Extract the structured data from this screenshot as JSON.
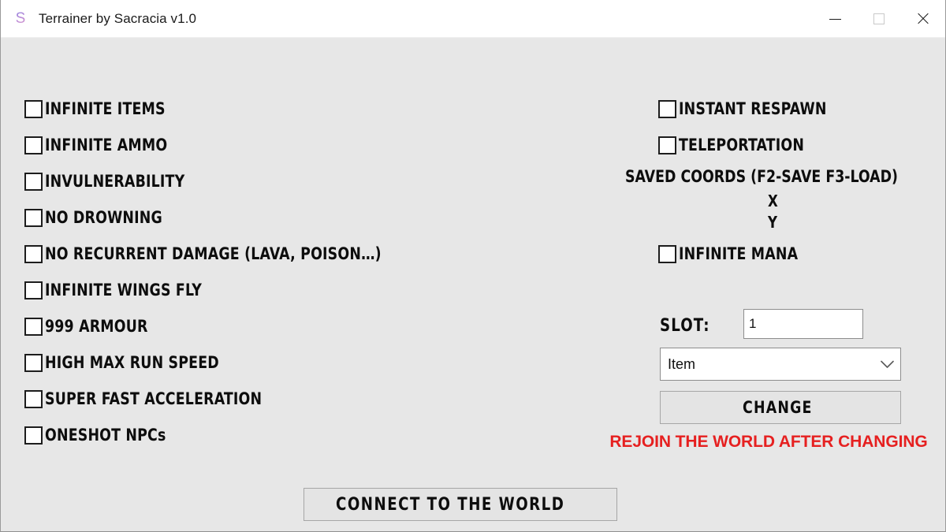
{
  "window": {
    "title": "Terrainer by Sacracia v1.0",
    "icon": "S",
    "controls": {
      "minimize": "minimize-icon",
      "maximize": "maximize-icon",
      "close": "close-icon"
    }
  },
  "left_column": {
    "checkboxes": [
      {
        "id": "infinite-items",
        "label": "INFINITE ITEMS",
        "checked": false
      },
      {
        "id": "infinite-ammo",
        "label": "INFINITE AMMO",
        "checked": false
      },
      {
        "id": "invulnerability",
        "label": "INVULNERABILITY",
        "checked": false
      },
      {
        "id": "no-drowning",
        "label": "NO DROWNING",
        "checked": false
      },
      {
        "id": "no-recurrent-damage",
        "label": "NO RECURRENT DAMAGE (LAVA, POISON…)",
        "checked": false
      },
      {
        "id": "infinite-wings-fly",
        "label": "INFINITE WINGS FLY",
        "checked": false
      },
      {
        "id": "999-armour",
        "label": "999 ARMOUR",
        "checked": false
      },
      {
        "id": "high-max-run-speed",
        "label": "HIGH MAX RUN SPEED",
        "checked": false
      },
      {
        "id": "super-fast-accel",
        "label": "SUPER FAST ACCELERATION",
        "checked": false
      },
      {
        "id": "oneshot-npcs",
        "label": "ONESHOT NPCs",
        "checked": false
      }
    ]
  },
  "right_column": {
    "checkboxes": [
      {
        "id": "instant-respawn",
        "label": "INSTANT RESPAWN",
        "checked": false
      },
      {
        "id": "teleportation",
        "label": "TELEPORTATION",
        "checked": false
      },
      {
        "id": "infinite-mana",
        "label": "INFINITE MANA",
        "checked": false
      }
    ],
    "saved_coords": {
      "title": "SAVED COORDS (F2-SAVE F3-LOAD)",
      "x_label": "X",
      "y_label": "Y",
      "x_value": "",
      "y_value": ""
    },
    "slot": {
      "label": "SLOT:",
      "value": "1",
      "placeholder": ""
    },
    "type_select": {
      "selected": "Item",
      "options": [
        "Item"
      ],
      "arrow": "chevron-down-icon"
    },
    "change_button": "CHANGE",
    "warning": "REJOIN THE WORLD AFTER CHANGING"
  },
  "footer": {
    "connect_button": "CONNECT TO THE WORLD"
  },
  "colors": {
    "window_bg": "#e7e7e7",
    "titlebar_bg": "#ffffff",
    "text": "#0d0d0d",
    "warning_red": "#e62020",
    "button_bg": "#e4e4e4",
    "button_border": "#a6a6a6",
    "input_border": "#8d8d8d"
  }
}
